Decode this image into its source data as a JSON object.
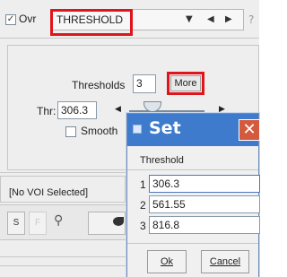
{
  "header": {
    "ovr_label": "Ovr",
    "ovr_checked": true,
    "threshold_selector": "THRESHOLD",
    "help": "?"
  },
  "thresholds_panel": {
    "thresholds_label": "Thresholds",
    "threshold_count": "3",
    "more_button": "More",
    "thr_label": "Thr:",
    "thr_value": "306.3",
    "smooth_label": "Smooth",
    "smooth_checked": false
  },
  "voi": {
    "label": "[No VOI Selected]"
  },
  "tools": {
    "s_label": "S",
    "f_label": "F"
  },
  "dialog": {
    "title": "Set",
    "group_label": "Threshold",
    "rows": [
      {
        "num": "1",
        "value": "306.3"
      },
      {
        "num": "2",
        "value": "561.55"
      },
      {
        "num": "3",
        "value": "816.8"
      }
    ],
    "ok_label": "Ok",
    "cancel_label": "Cancel"
  },
  "colors": {
    "highlight": "#e0151b",
    "dialog_title_bg": "#3f7bcc",
    "close_bg": "#d45a3d"
  },
  "icons": [
    "checkbox-checked-icon",
    "dropdown-arrow-icon",
    "left-arrow-icon",
    "right-arrow-icon",
    "pin-icon",
    "paint-tool-icon",
    "dialog-app-icon",
    "close-icon"
  ]
}
